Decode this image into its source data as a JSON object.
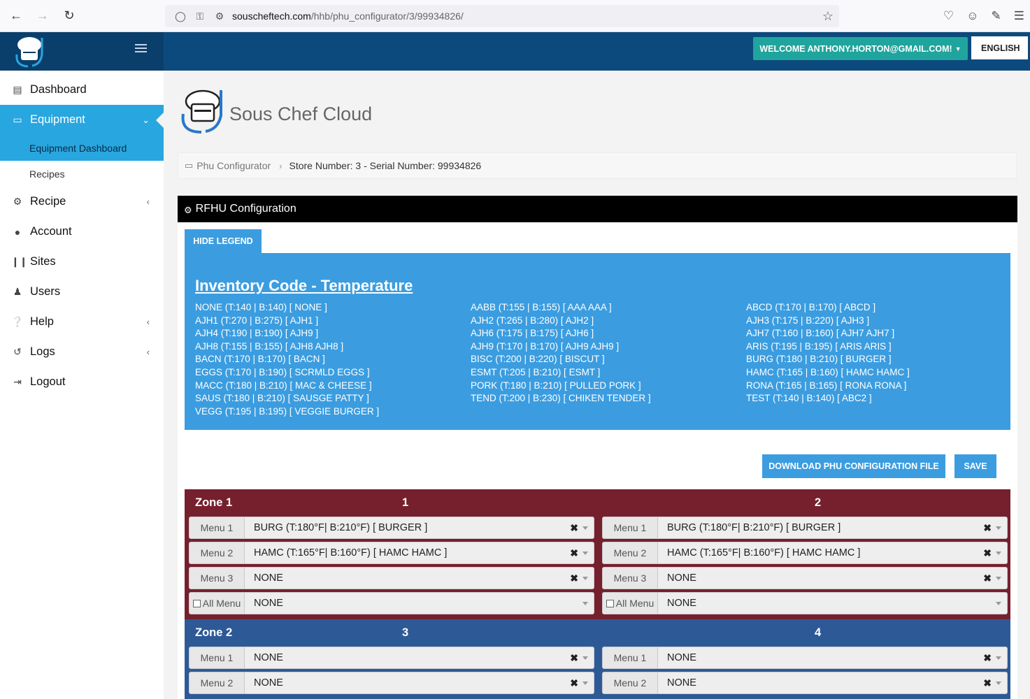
{
  "browser": {
    "url_host": "souscheftech.com",
    "url_path": "/hhb/phu_configurator/3/99934826/"
  },
  "header": {
    "welcome": "WELCOME ANTHONY.HORTON@GMAIL.COM!",
    "language": "ENGLISH"
  },
  "sidebar": {
    "items": [
      {
        "label": "Dashboard"
      },
      {
        "label": "Equipment"
      },
      {
        "label": "Equipment Dashboard"
      },
      {
        "label": "Recipes"
      },
      {
        "label": "Recipe"
      },
      {
        "label": "Account"
      },
      {
        "label": "Sites"
      },
      {
        "label": "Users"
      },
      {
        "label": "Help"
      },
      {
        "label": "Logs"
      },
      {
        "label": "Logout"
      }
    ]
  },
  "brand": {
    "title": "Sous Chef Cloud"
  },
  "breadcrumb": {
    "root": "Phu Configurator",
    "current": "Store Number: 3 - Serial Number: 99934826"
  },
  "panel": {
    "title": "RFHU Configuration"
  },
  "legend": {
    "toggle_label": "HIDE LEGEND",
    "title": "Inventory Code - Temperature",
    "entries": [
      "NONE (T:140 | B:140) [ NONE ]",
      "AABB (T:155 | B:155) [ AAA AAA ]",
      "ABCD (T:170 | B:170) [ ABCD ]",
      "AJH1 (T:270 | B:275) [ AJH1 ]",
      "AJH2 (T:265 | B:280) [ AJH2 ]",
      "AJH3 (T:175 | B:220) [ AJH3 ]",
      "AJH4 (T:190 | B:190) [ AJH9 ]",
      "AJH6 (T:175 | B:175) [ AJH6 ]",
      "AJH7 (T:160 | B:160) [ AJH7 AJH7 ]",
      "AJH8 (T:155 | B:155) [ AJH8 AJH8 ]",
      "AJH9 (T:170 | B:170) [ AJH9 AJH9 ]",
      "ARIS (T:195 | B:195) [ ARIS ARIS ]",
      "BACN (T:170 | B:170) [ BACN ]",
      "BISC (T:200 | B:220) [ BISCUT ]",
      "BURG (T:180 | B:210) [ BURGER ]",
      "EGGS (T:170 | B:190) [ SCRMLD EGGS ]",
      "ESMT (T:205 | B:210) [ ESMT ]",
      "HAMC (T:165 | B:160) [ HAMC HAMC ]",
      "MACC (T:180 | B:210) [ MAC & CHEESE ]",
      "PORK (T:180 | B:210) [ PULLED PORK ]",
      "RONA (T:165 | B:165) [ RONA RONA ]",
      "SAUS (T:180 | B:210) [ SAUSGE PATTY ]",
      "TEND (T:200 | B:230) [ CHIKEN TENDER ]",
      "TEST (T:140 | B:140) [ ABC2 ]",
      "VEGG (T:195 | B:195) [ VEGGIE BURGER ]"
    ]
  },
  "actions": {
    "download": "DOWNLOAD PHU CONFIGURATION FILE",
    "save": "SAVE"
  },
  "zones": [
    {
      "name": "Zone 1",
      "col_a": "1",
      "col_b": "2",
      "color": "#761f2d",
      "rows_a": [
        {
          "label": "Menu 1",
          "value": "BURG (T:180°F| B:210°F) [ BURGER  ]"
        },
        {
          "label": "Menu 2",
          "value": "HAMC (T:165°F| B:160°F) [ HAMC HAMC ]"
        },
        {
          "label": "Menu 3",
          "value": "NONE"
        },
        {
          "label": "All Menu",
          "value": "NONE"
        }
      ],
      "rows_b": [
        {
          "label": "Menu 1",
          "value": "BURG (T:180°F| B:210°F) [ BURGER  ]"
        },
        {
          "label": "Menu 2",
          "value": "HAMC (T:165°F| B:160°F) [ HAMC HAMC ]"
        },
        {
          "label": "Menu 3",
          "value": "NONE"
        },
        {
          "label": "All Menu",
          "value": "NONE"
        }
      ]
    },
    {
      "name": "Zone 2",
      "col_a": "3",
      "col_b": "4",
      "color": "#2d5a96",
      "rows_a": [
        {
          "label": "Menu 1",
          "value": "NONE"
        },
        {
          "label": "Menu 2",
          "value": "NONE"
        }
      ],
      "rows_b": [
        {
          "label": "Menu 1",
          "value": "NONE"
        },
        {
          "label": "Menu 2",
          "value": "NONE"
        }
      ]
    }
  ],
  "clear_glyph": "✖"
}
